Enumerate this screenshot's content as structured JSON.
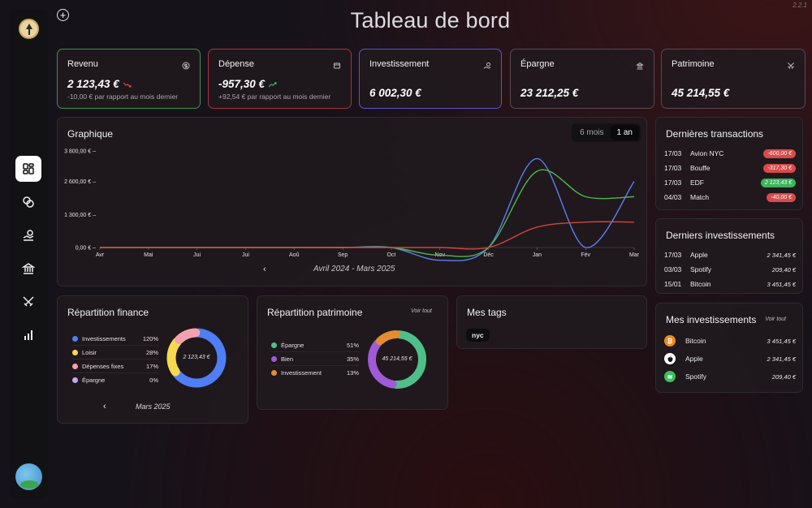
{
  "app": {
    "version": "2.2.1",
    "page_title": "Tableau de bord"
  },
  "stats": [
    {
      "label": "Revenu",
      "amount": "2 123,43 €",
      "sub": "-10,00 € par rapport au mois dernier",
      "trend": "down",
      "border": "#3f8f4a"
    },
    {
      "label": "Dépense",
      "amount": "-957,30 €",
      "sub": "+92,54 € par rapport au mois dernier",
      "trend": "up",
      "border": "#a6333a"
    },
    {
      "label": "Investissement",
      "amount": "6 002,30 €",
      "border": "#5a54c7"
    },
    {
      "label": "Épargne",
      "amount": "23 212,25 €",
      "border": "#5a4a50"
    },
    {
      "label": "Patrimoine",
      "amount": "45 214,55 €",
      "border": "#5a4a50"
    }
  ],
  "chart": {
    "title": "Graphique",
    "ranges": [
      "6 mois",
      "1 an"
    ],
    "selected_range": "1 an",
    "period": "Avril 2024 - Mars 2025"
  },
  "chart_data": {
    "type": "line",
    "categories": [
      "Avr",
      "Mai",
      "Jui",
      "Jui",
      "Aoû",
      "Sep",
      "Oct",
      "Nov",
      "Déc",
      "Jan",
      "Fév",
      "Mar"
    ],
    "yticks": [
      "3 800,00 €",
      "2 600,00 €",
      "1 300,00 €",
      "0,00 €"
    ],
    "ylim": [
      0,
      3800
    ],
    "series": [
      {
        "color": "#5b7ff0",
        "values": [
          0,
          0,
          0,
          0,
          0,
          0,
          0,
          -500,
          0,
          3500,
          0,
          2600
        ]
      },
      {
        "color": "#4fb84f",
        "values": [
          0,
          0,
          0,
          0,
          0,
          0,
          0,
          -300,
          0,
          3000,
          2000,
          2000
        ]
      },
      {
        "color": "#d0463e",
        "values": [
          0,
          0,
          0,
          0,
          0,
          0,
          0,
          0,
          0,
          800,
          1000,
          1000
        ]
      }
    ]
  },
  "transactions": {
    "title": "Dernières transactions",
    "rows": [
      {
        "date": "17/03",
        "name": "Avion NYC",
        "amount": "-600,00 €",
        "kind": "red"
      },
      {
        "date": "17/03",
        "name": "Bouffe",
        "amount": "-317,30 €",
        "kind": "red"
      },
      {
        "date": "17/03",
        "name": "EDF",
        "amount": "2 123,43 €",
        "kind": "green"
      },
      {
        "date": "04/03",
        "name": "Match",
        "amount": "-40,00 €",
        "kind": "red"
      }
    ]
  },
  "last_investments": {
    "title": "Derniers investissements",
    "rows": [
      {
        "date": "17/03",
        "name": "Apple",
        "value": "2 341,45 €"
      },
      {
        "date": "03/03",
        "name": "Spotify",
        "value": "209,40 €"
      },
      {
        "date": "15/01",
        "name": "Bitcoin",
        "value": "3 451,45 €"
      }
    ]
  },
  "my_investments": {
    "title": "Mes investissements",
    "see_all": "Voir tout",
    "rows": [
      {
        "name": "Bitcoin",
        "value": "3 451,45 €",
        "icon": "bitcoin-icon",
        "color": "#f08c1a"
      },
      {
        "name": "Apple",
        "value": "2 341,45 €",
        "icon": "apple-icon",
        "color": "#ffffff"
      },
      {
        "name": "Spotify",
        "value": "209,40 €",
        "icon": "spotify-icon",
        "color": "#3bc05a"
      }
    ]
  },
  "finance": {
    "title": "Répartition finance",
    "period": "Mars 2025",
    "total": "2 123,43 €",
    "items": [
      {
        "name": "Investissements",
        "pct": "120%",
        "color": "#4f7ef5",
        "value": 0.58
      },
      {
        "name": "Loisir",
        "pct": "28%",
        "color": "#f5d94f",
        "value": 0.2
      },
      {
        "name": "Dépenses fixes",
        "pct": "17%",
        "color": "#f3a1b0",
        "value": 0.12
      },
      {
        "name": "Épargne",
        "pct": "0%",
        "color": "#c9a8f0",
        "value": 0.0
      }
    ]
  },
  "patrimoine": {
    "title": "Répartition patrimoine",
    "see_all": "Voir tout",
    "total": "45 214,55 €",
    "items": [
      {
        "name": "Épargne",
        "pct": "51%",
        "color": "#4fbf8a",
        "value": 0.51
      },
      {
        "name": "Bien",
        "pct": "35%",
        "color": "#a05ad8",
        "value": 0.35
      },
      {
        "name": "Investissement",
        "pct": "13%",
        "color": "#e58c30",
        "value": 0.13
      }
    ]
  },
  "tags": {
    "title": "Mes tags",
    "items": [
      "nyc"
    ]
  }
}
